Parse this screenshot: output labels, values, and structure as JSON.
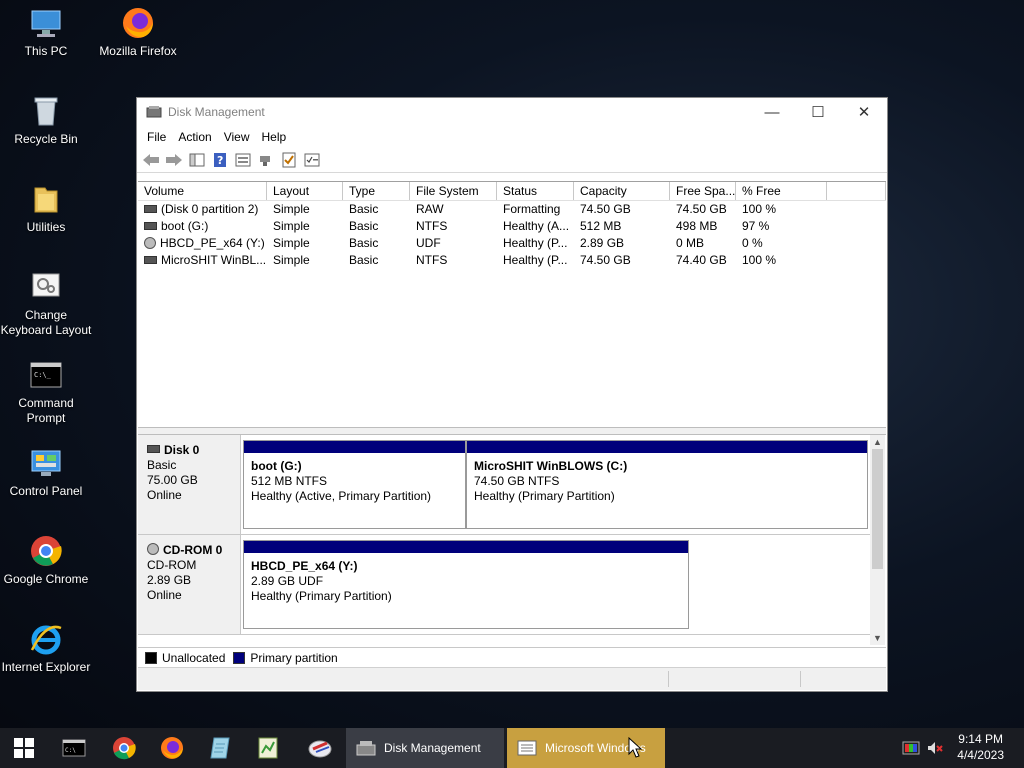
{
  "desktop": {
    "icons": [
      {
        "label": "This PC"
      },
      {
        "label": "Mozilla Firefox"
      },
      {
        "label": "Recycle Bin"
      },
      {
        "label": "Utilities"
      },
      {
        "label": "Change Keyboard Layout"
      },
      {
        "label": "Command Prompt"
      },
      {
        "label": "Control Panel"
      },
      {
        "label": "Google Chrome"
      },
      {
        "label": "Internet Explorer"
      }
    ]
  },
  "window": {
    "title": "Disk Management",
    "controls": {
      "minimize": "—",
      "maximize": "☐",
      "close": "✕"
    },
    "menu": [
      "File",
      "Action",
      "View",
      "Help"
    ],
    "columns": [
      "Volume",
      "Layout",
      "Type",
      "File System",
      "Status",
      "Capacity",
      "Free Spa...",
      "% Free",
      ""
    ],
    "rows": [
      {
        "icon": "disk",
        "cells": [
          "(Disk 0 partition 2)",
          "Simple",
          "Basic",
          "RAW",
          "Formatting",
          "74.50 GB",
          "74.50 GB",
          "100 %"
        ]
      },
      {
        "icon": "disk",
        "cells": [
          "boot (G:)",
          "Simple",
          "Basic",
          "NTFS",
          "Healthy (A...",
          "512 MB",
          "498 MB",
          "97 %"
        ]
      },
      {
        "icon": "cd",
        "cells": [
          "HBCD_PE_x64 (Y:)",
          "Simple",
          "Basic",
          "UDF",
          "Healthy (P...",
          "2.89 GB",
          "0 MB",
          "0 %"
        ]
      },
      {
        "icon": "disk",
        "cells": [
          "MicroSHIT WinBL...",
          "Simple",
          "Basic",
          "NTFS",
          "Healthy (P...",
          "74.50 GB",
          "74.40 GB",
          "100 %"
        ]
      }
    ],
    "disks": [
      {
        "name": "Disk 0",
        "type": "Basic",
        "size": "75.00 GB",
        "state": "Online",
        "partitions": [
          {
            "name": "boot  (G:)",
            "size": "512 MB NTFS",
            "status": "Healthy (Active, Primary Partition)"
          },
          {
            "name": "MicroSHIT WinBLOWS  (C:)",
            "size": "74.50 GB NTFS",
            "status": "Healthy (Primary Partition)"
          }
        ]
      },
      {
        "name": "CD-ROM 0",
        "type": "CD-ROM",
        "size": "2.89 GB",
        "state": "Online",
        "partitions": [
          {
            "name": "HBCD_PE_x64  (Y:)",
            "size": "2.89 GB UDF",
            "status": "Healthy (Primary Partition)"
          }
        ]
      }
    ],
    "legend": [
      {
        "label": "Unallocated",
        "color": "#000000"
      },
      {
        "label": "Primary partition",
        "color": "#00007b"
      }
    ]
  },
  "taskbar": {
    "tasks": [
      {
        "label": "Disk Management"
      },
      {
        "label": "Microsoft Windows"
      }
    ],
    "clock": {
      "time": "9:14 PM",
      "date": "4/4/2023"
    }
  },
  "colors": {
    "accent_task": "#c8a040",
    "primary_partition": "#00007b"
  }
}
